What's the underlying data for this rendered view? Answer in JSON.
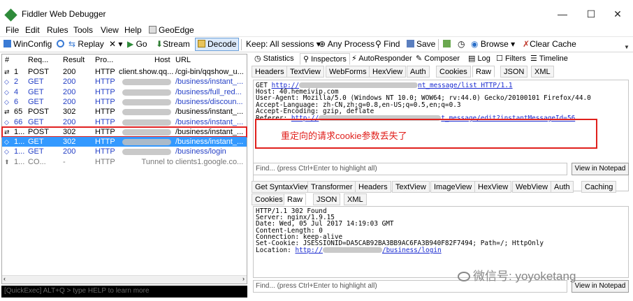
{
  "window": {
    "title": "Fiddler Web Debugger",
    "minimize": "—",
    "maximize": "☐",
    "close": "✕"
  },
  "menu": [
    "File",
    "Edit",
    "Rules",
    "Tools",
    "View",
    "Help",
    "GeoEdge"
  ],
  "toolbar": {
    "winconfig": "WinConfig",
    "replay": "Replay",
    "remove": "✕ ▾",
    "go": "Go",
    "stream": "Stream",
    "decode": "Decode",
    "keep": "Keep: All sessions ▾",
    "any_process": "Any Process",
    "find": "Find",
    "save": "Save",
    "browse": "Browse ▾",
    "clear_cache": "Clear Cache"
  },
  "sessions": {
    "columns": [
      "#",
      "Req...",
      "Result",
      "Pro...",
      "Host",
      "URL"
    ],
    "rows": [
      {
        "num": "1",
        "method": "POST",
        "result": "200",
        "protocol": "HTTP",
        "host": "client.show.qq....",
        "url": "/cgi-bin/qqshow_u...",
        "style": "black"
      },
      {
        "num": "2",
        "method": "GET",
        "result": "200",
        "protocol": "HTTP",
        "host": "",
        "url": "/business/instant_...",
        "style": "normal"
      },
      {
        "num": "4",
        "method": "GET",
        "result": "200",
        "protocol": "HTTP",
        "host": "",
        "url": "/business/full_red...",
        "style": "normal"
      },
      {
        "num": "6",
        "method": "GET",
        "result": "200",
        "protocol": "HTTP",
        "host": "",
        "url": "/business/discoun...",
        "style": "normal"
      },
      {
        "num": "65",
        "method": "POST",
        "result": "302",
        "protocol": "HTTP",
        "host": "",
        "url": "/business/instant_...",
        "style": "black"
      },
      {
        "num": "66",
        "method": "GET",
        "result": "200",
        "protocol": "HTTP",
        "host": "",
        "url": "/business/instant_...",
        "style": "normal"
      },
      {
        "num": "1...",
        "method": "POST",
        "result": "302",
        "protocol": "HTTP",
        "host": "",
        "url": "/business/instant_...",
        "style": "boxed"
      },
      {
        "num": "1...",
        "method": "GET",
        "result": "302",
        "protocol": "HTTP",
        "host": "",
        "url": "/business/instant_...",
        "style": "sel"
      },
      {
        "num": "1...",
        "method": "GET",
        "result": "200",
        "protocol": "HTTP",
        "host": "",
        "url": "/business/login",
        "style": "normal"
      },
      {
        "num": "1...",
        "method": "CO...",
        "result": "-",
        "protocol": "HTTP",
        "host": "Tunnel to",
        "url": "clients1.google.co...",
        "style": "grey"
      }
    ]
  },
  "quickexec": "[QuickExec] ALT+Q > type HELP to learn more",
  "top_tabs": [
    "Statistics",
    "Inspectors",
    "AutoResponder",
    "Composer",
    "Log",
    "Filters",
    "Timeline"
  ],
  "request_tabs": [
    "Headers",
    "TextView",
    "WebForms",
    "HexView",
    "Auth",
    "Cookies",
    "Raw",
    "JSON",
    "XML"
  ],
  "request_raw": {
    "line1_prefix": "GET ",
    "line1_link": "http://",
    "line1_tail": "nt_message/list HTTP/1.1",
    "host": "Host: 40.hemeivip.com",
    "ua": "User-Agent: Mozilla/5.0 (Windows NT 10.0; WOW64; rv:44.0) Gecko/20100101 Firefox/44.0",
    "lang": "Accept-Language: zh-CN,zh;q=0.8,en-US;q=0.5,en;q=0.3",
    "enc": "Accept-Encoding: gzip, deflate",
    "referer_prefix": "Referer: ",
    "referer_link": "http://",
    "referer_tail": "t_message/edit?instantMessageId=56"
  },
  "annotation": "重定向的请求cookie参数丢失了",
  "find_placeholder": "Find... (press Ctrl+Enter to highlight all)",
  "view_in_notepad": "View in Notepad",
  "response_tabs_row1": [
    "Get SyntaxView",
    "Transformer",
    "Headers",
    "TextView",
    "ImageView",
    "HexView",
    "WebView",
    "Auth",
    "Caching"
  ],
  "response_tabs_row2": [
    "Cookies",
    "Raw",
    "JSON",
    "XML"
  ],
  "response_raw": {
    "status": "HTTP/1.1 302 Found",
    "server": "Server: nginx/1.9.15",
    "date": "Date: Wed, 05 Jul 2017 14:19:03 GMT",
    "length": "Content-Length: 0",
    "conn": "Connection: keep-alive",
    "cookie": "Set-Cookie: JSESSIONID=DA5CAB92BA3BB9AC6FA3B940F82F7494; Path=/; HttpOnly",
    "location_prefix": "Location: ",
    "location_link": "http://",
    "location_tail": "/business/login"
  },
  "watermark": "微信号: yoyoketang",
  "colors": {
    "selected_row": "#3399ff",
    "annotation": "#e0201c",
    "link": "#1a2bd0"
  }
}
